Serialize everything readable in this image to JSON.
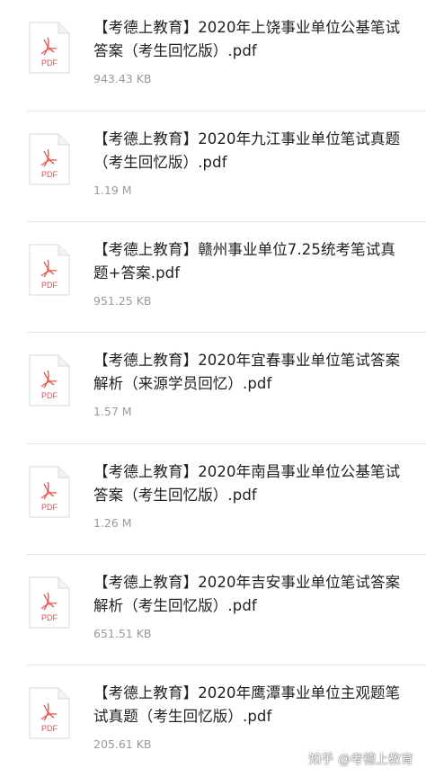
{
  "files": [
    {
      "name": "【考德上教育】2020年上饶事业单位公基笔试答案（考生回忆版）.pdf",
      "size": "943.43 KB",
      "icon": "pdf-file-icon",
      "icon_label": "PDF"
    },
    {
      "name": "【考德上教育】2020年九江事业单位笔试真题（考生回忆版）.pdf",
      "size": "1.19 M",
      "icon": "pdf-file-icon",
      "icon_label": "PDF"
    },
    {
      "name": "【考德上教育】赣州事业单位7.25统考笔试真题+答案.pdf",
      "size": "951.25 KB",
      "icon": "pdf-file-icon",
      "icon_label": "PDF"
    },
    {
      "name": "【考德上教育】2020年宜春事业单位笔试答案解析（来源学员回忆）.pdf",
      "size": "1.57 M",
      "icon": "pdf-file-icon",
      "icon_label": "PDF"
    },
    {
      "name": "【考德上教育】2020年南昌事业单位公基笔试答案（考生回忆版）.pdf",
      "size": "1.26 M",
      "icon": "pdf-file-icon",
      "icon_label": "PDF"
    },
    {
      "name": "【考德上教育】2020年吉安事业单位笔试答案解析（考生回忆版）.pdf",
      "size": "651.51 KB",
      "icon": "pdf-file-icon",
      "icon_label": "PDF"
    },
    {
      "name": "【考德上教育】2020年鹰潭事业单位主观题笔试真题（考生回忆版）.pdf",
      "size": "205.61 KB",
      "icon": "pdf-file-icon",
      "icon_label": "PDF"
    }
  ],
  "watermark": "知乎 @考德上教育",
  "colors": {
    "pdf_accent": "#e64c45",
    "text_primary": "#1f1f1f",
    "text_secondary": "#9a9a9a",
    "divider": "#e3e3e3"
  }
}
